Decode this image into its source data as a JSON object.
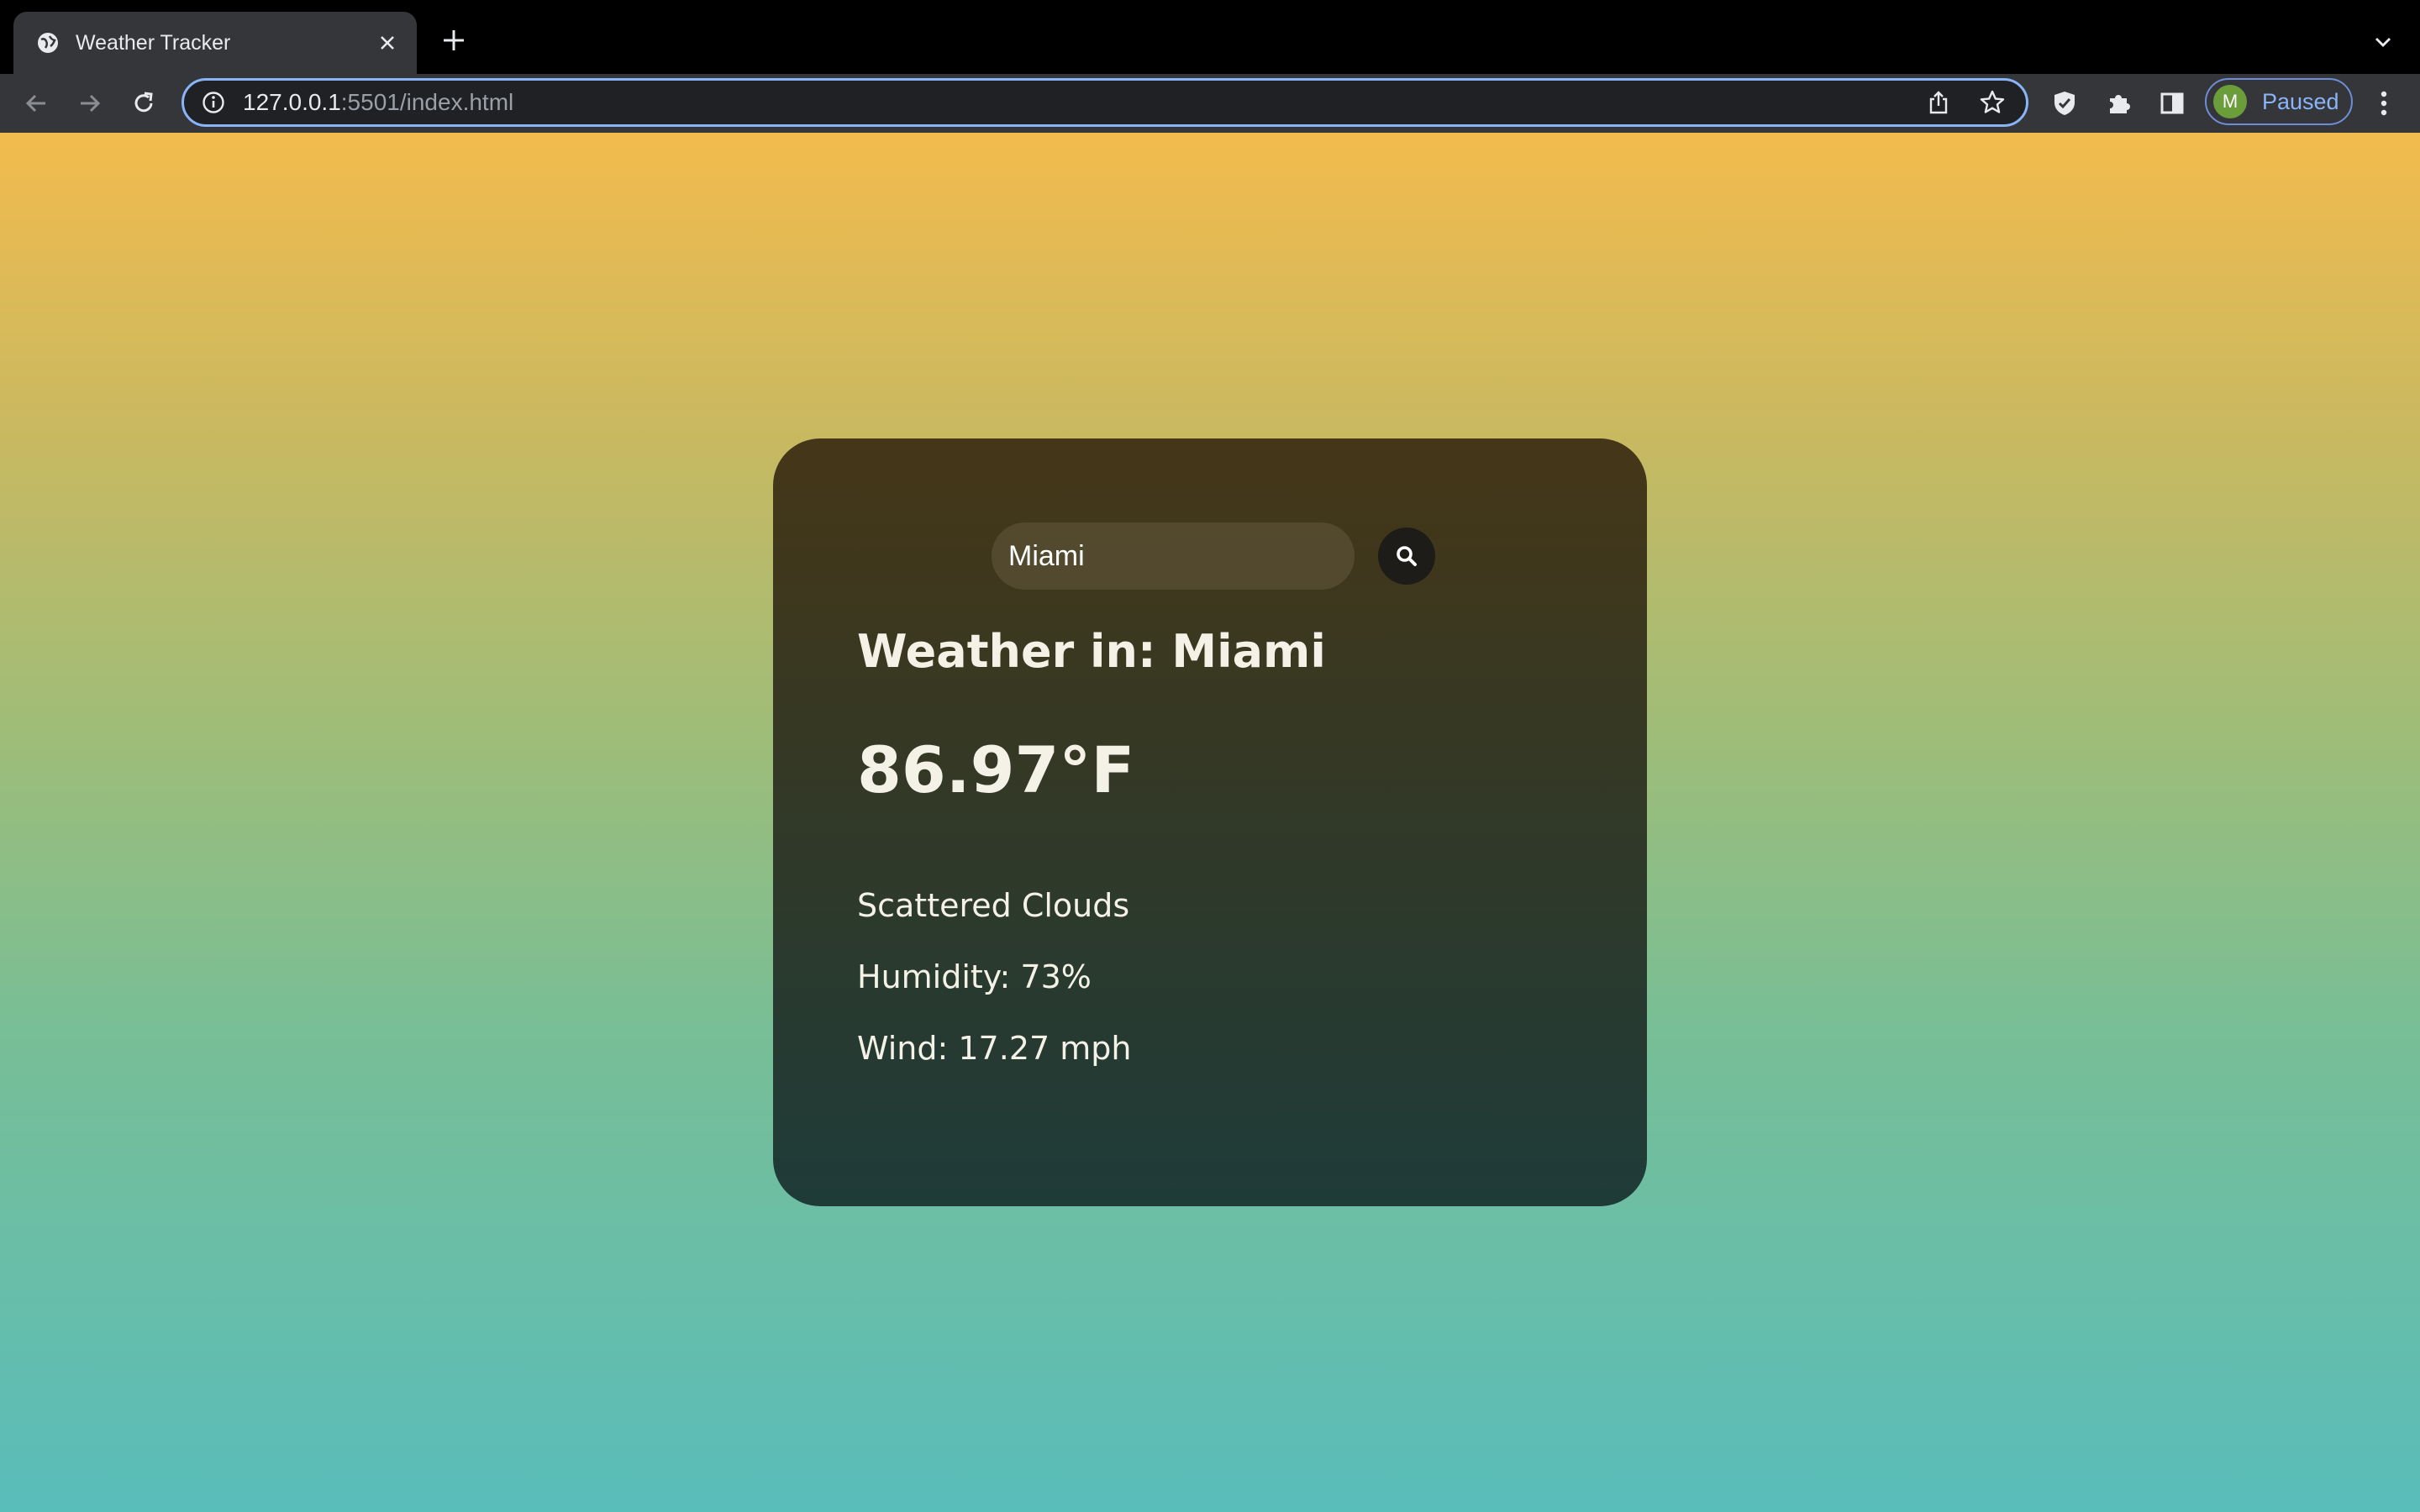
{
  "browser": {
    "tab_title": "Weather Tracker",
    "url_host": "127.0.0.1",
    "url_rest": ":5501/index.html",
    "profile_initial": "M",
    "profile_status": "Paused"
  },
  "search": {
    "value": "Miami"
  },
  "weather": {
    "title": "Weather in: Miami",
    "temperature": "86.97°F",
    "description": "Scattered Clouds",
    "humidity": "Humidity: 73%",
    "wind": "Wind: 17.27 mph"
  },
  "icons": {
    "favicon": "globe-icon",
    "search": "search-icon"
  },
  "colors": {
    "accent": "#8ab4f8",
    "gradient_top": "#f3bb4d",
    "gradient_bottom": "#59bdba"
  }
}
